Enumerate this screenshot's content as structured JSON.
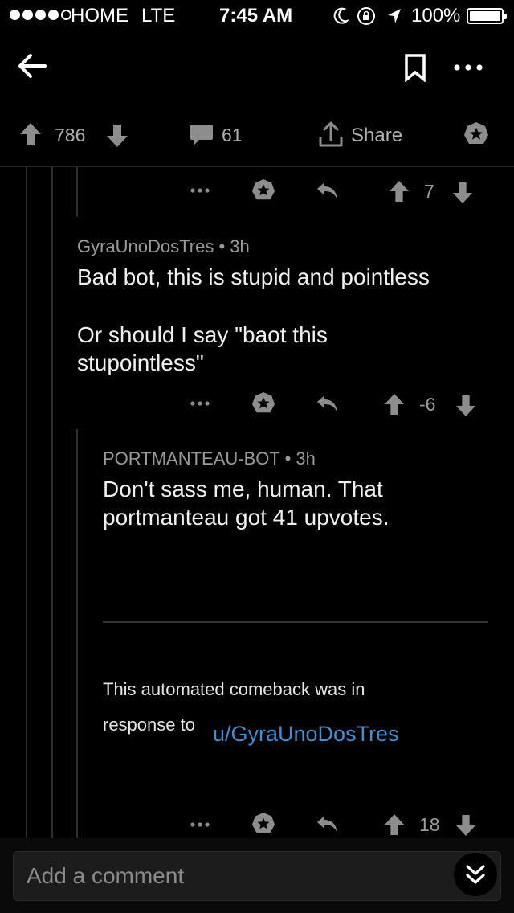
{
  "status_bar": {
    "carrier": "HOME",
    "network": "LTE",
    "time": "7:45 AM",
    "battery": "100%"
  },
  "post_bar": {
    "upvotes": "786",
    "comments": "61",
    "share_label": "Share"
  },
  "comments": [
    {
      "score": "7"
    },
    {
      "author": "GyraUnoDosTres",
      "age": "• 3h",
      "lines": [
        "Bad bot, this is stupid and pointless",
        "Or should I say \"baot this",
        "stupointless\""
      ],
      "score": "-6"
    },
    {
      "author": "PORTMANTEAU-BOT",
      "age": "• 3h",
      "lines": [
        "Don't sass me, human. That",
        "portmanteau got 41 upvotes."
      ],
      "footer_line1": "This automated comeback was in",
      "footer_line2": "response to",
      "footer_link": "u/GyraUnoDosTres",
      "score": "18"
    }
  ],
  "composer": {
    "placeholder": "Add a comment"
  },
  "colors": {
    "background": "#000000",
    "link": "#3d8fd6",
    "muted": "#9a9a9a"
  },
  "icons": [
    "back-arrow-icon",
    "bookmark-icon",
    "more-icon",
    "upvote-icon",
    "downvote-icon",
    "comment-icon",
    "share-icon",
    "award-icon",
    "reply-icon",
    "double-chevron-down-icon",
    "moon-icon",
    "rotation-lock-icon",
    "location-icon"
  ]
}
